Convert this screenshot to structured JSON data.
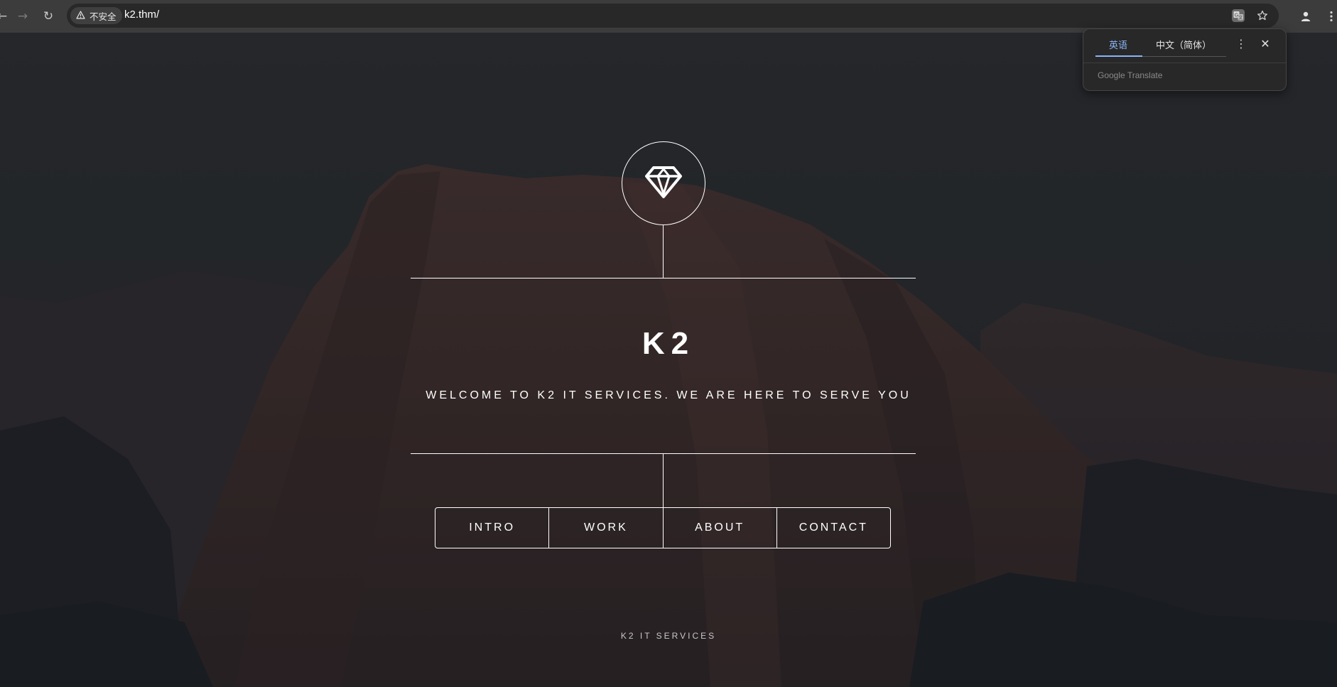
{
  "browser": {
    "back_glyph": "←",
    "forward_glyph": "→",
    "reload_glyph": "↻",
    "security_label": "不安全",
    "url": "k2.thm/",
    "icons": [
      "back-icon",
      "forward-icon",
      "reload-icon",
      "warning-icon",
      "translate-icon",
      "star-icon",
      "profile-icon",
      "menu-icon"
    ]
  },
  "translate_popup": {
    "source_tab": "英语",
    "target_tab": "中文（简体）",
    "brand": "Google Translate",
    "more_glyph": "⋮",
    "close_glyph": "✕",
    "accent_color": "#8ab4f8"
  },
  "site": {
    "logo_icon": "diamond-icon",
    "title": "K2",
    "tagline": "WELCOME TO K2 IT SERVICES. WE ARE HERE TO SERVE YOU",
    "nav": [
      "INTRO",
      "WORK",
      "ABOUT",
      "CONTACT"
    ],
    "footer": "K2 IT SERVICES"
  }
}
